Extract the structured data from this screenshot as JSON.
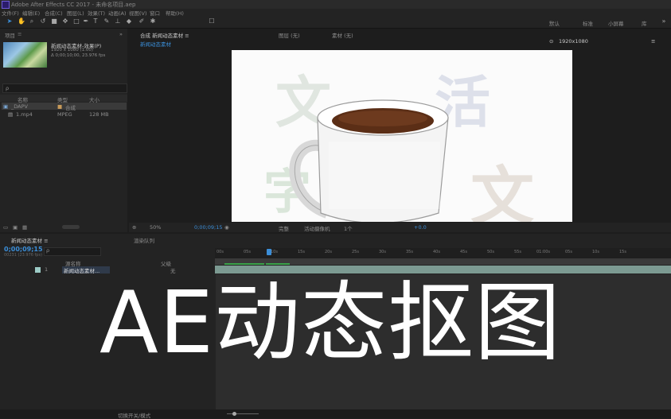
{
  "titlebar": {
    "title": "Adobe After Effects CC 2017 - 未命名项目.aep"
  },
  "menu": [
    "文件(F)",
    "编辑(E)",
    "合成(C)",
    "图层(L)",
    "效果(T)",
    "动画(A)",
    "视图(V)",
    "窗口",
    "帮助(H)"
  ],
  "toolbar": {
    "workspace_default": "默认",
    "workspace_standard": "标准",
    "workspace_small": "小屏幕",
    "workspace_library": "库"
  },
  "project": {
    "tab_label": "项目",
    "file_name": "新闻动态素材-效果(P)",
    "file_info1": "1920 x 1080 (1.00)",
    "file_info2": "Δ 0;00;10;00, 23.976 fps",
    "search_placeholder": "ρ",
    "columns": {
      "name": "名称",
      "type": "类型",
      "size": "大小"
    },
    "rows": [
      {
        "name": "_DAPV",
        "type": "合成",
        "size": ""
      },
      {
        "name": "1.mp4",
        "type": "MPEG",
        "size": "128 MB"
      }
    ]
  },
  "viewer": {
    "tab": "合成 新闻动态素材 ≡",
    "subtab": "新闻动态素材",
    "layer_tab": "图层 (无)",
    "footage_tab": "素材 (无)",
    "resolution": "1920x1080",
    "zoom": "50%",
    "timecode": "0;00;09;15",
    "quality": "完整",
    "camera": "活动摄像机",
    "views": "1个"
  },
  "timeline": {
    "tab": "新闻动态素材 ≡",
    "render_tab": "渲染队列",
    "timecode": "0;00;09;15",
    "frame_info": "00231 (23.976 fps)",
    "search_placeholder": "ρ",
    "column_source": "源名称",
    "column_parent": "父级",
    "layer_name": "新闻动态素材...",
    "layer_index": "1",
    "parent_value": "无",
    "ruler_ticks": [
      "00s",
      "05s",
      "10s",
      "15s",
      "20s",
      "25s",
      "30s",
      "35s",
      "40s",
      "45s",
      "50s",
      "55s",
      "01:00s",
      "05s",
      "10s",
      "15s"
    ]
  },
  "canvas_watermark": [
    "文",
    "活",
    "文",
    "字"
  ],
  "overlay_title": "AE动态抠图",
  "statusbar": {
    "toggle": "切换开关/模式"
  },
  "colors": {
    "accent": "#3b8ed8",
    "panel": "#232323",
    "overlay": "#2d2d2d"
  }
}
